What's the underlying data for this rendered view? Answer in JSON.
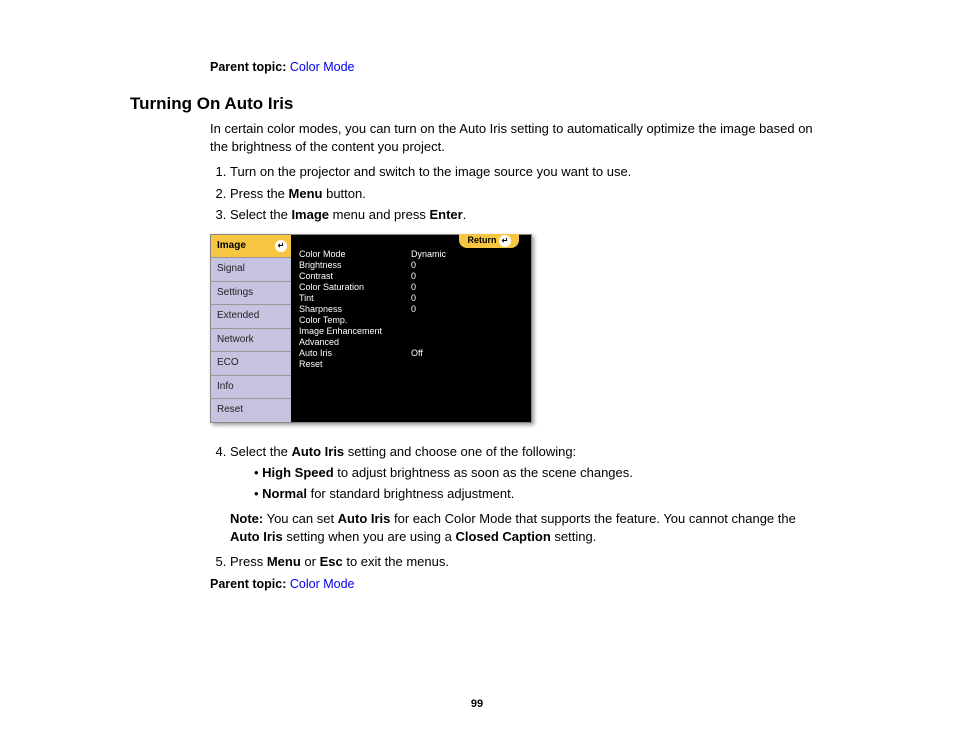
{
  "parentTopic": {
    "label": "Parent topic:",
    "linkText": "Color Mode"
  },
  "title": "Turning On Auto Iris",
  "intro": "In certain color modes, you can turn on the Auto Iris setting to automatically optimize the image based on the brightness of the content you project.",
  "step1": "Turn on the projector and switch to the image source you want to use.",
  "step2_pre": "Press the ",
  "step2_bold": "Menu",
  "step2_post": " button.",
  "step3_pre": "Select the ",
  "step3_bold1": "Image",
  "step3_mid": " menu and press ",
  "step3_bold2": "Enter",
  "step3_post": ".",
  "step4_pre": "Select the ",
  "step4_bold": "Auto Iris",
  "step4_post": " setting and choose one of the following:",
  "bullet1_bold": "High Speed",
  "bullet1_post": " to adjust brightness as soon as the scene changes.",
  "bullet2_bold": "Normal",
  "bullet2_post": " for standard brightness adjustment.",
  "note_label": "Note:",
  "note_p1": " You can set ",
  "note_b1": "Auto Iris",
  "note_p2": " for each Color Mode that supports the feature. You cannot change the ",
  "note_b2": "Auto Iris",
  "note_p3": " setting when you are using a ",
  "note_b3": "Closed Caption",
  "note_p4": " setting.",
  "step5_pre": "Press ",
  "step5_b1": "Menu",
  "step5_mid": " or ",
  "step5_b2": "Esc",
  "step5_post": " to exit the menus.",
  "osd": {
    "return": "Return",
    "tabs": [
      "Image",
      "Signal",
      "Settings",
      "Extended",
      "Network",
      "ECO",
      "Info",
      "Reset"
    ],
    "rows": [
      {
        "k": "Color Mode",
        "v": "Dynamic"
      },
      {
        "k": "Brightness",
        "v": "0"
      },
      {
        "k": "Contrast",
        "v": "0"
      },
      {
        "k": "Color Saturation",
        "v": "0"
      },
      {
        "k": "Tint",
        "v": "0"
      },
      {
        "k": "Sharpness",
        "v": "0"
      },
      {
        "k": "Color Temp.",
        "v": ""
      },
      {
        "k": "Image Enhancement",
        "v": ""
      },
      {
        "k": "Advanced",
        "v": ""
      },
      {
        "k": "Auto Iris",
        "v": "Off"
      },
      {
        "k": "Reset",
        "v": ""
      }
    ]
  },
  "pageNumber": "99"
}
